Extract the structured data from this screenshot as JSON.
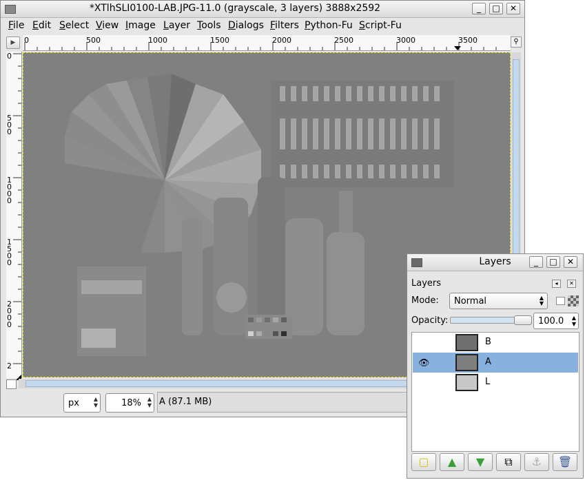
{
  "image_window": {
    "title": "*XTlhSLI0100-LAB.JPG-11.0 (grayscale, 3 layers) 3888x2592",
    "menu": [
      "File",
      "Edit",
      "Select",
      "View",
      "Image",
      "Layer",
      "Tools",
      "Dialogs",
      "Filters",
      "Python-Fu",
      "Script-Fu"
    ],
    "ruler_h": [
      "0",
      "500",
      "1000",
      "1500",
      "2000",
      "2500",
      "3000",
      "3500"
    ],
    "ruler_v": [
      "0",
      "500",
      "1000",
      "1500",
      "2000",
      "2"
    ],
    "unit": "px",
    "zoom": "18%",
    "status": "A (87.1 MB)"
  },
  "layers_dock": {
    "title": "Layers",
    "tab_label": "Layers",
    "mode_label": "Mode:",
    "mode_value": "Normal",
    "opacity_label": "Opacity:",
    "opacity_value": "100.0",
    "layers": [
      {
        "name": "B",
        "visible": false,
        "selected": false
      },
      {
        "name": "A",
        "visible": true,
        "selected": true
      },
      {
        "name": "L",
        "visible": false,
        "selected": false
      }
    ]
  },
  "colors": {
    "selection": "#89b1e0",
    "canvas": "#7f7f7f",
    "new_layer_green": "#3aa03a"
  }
}
